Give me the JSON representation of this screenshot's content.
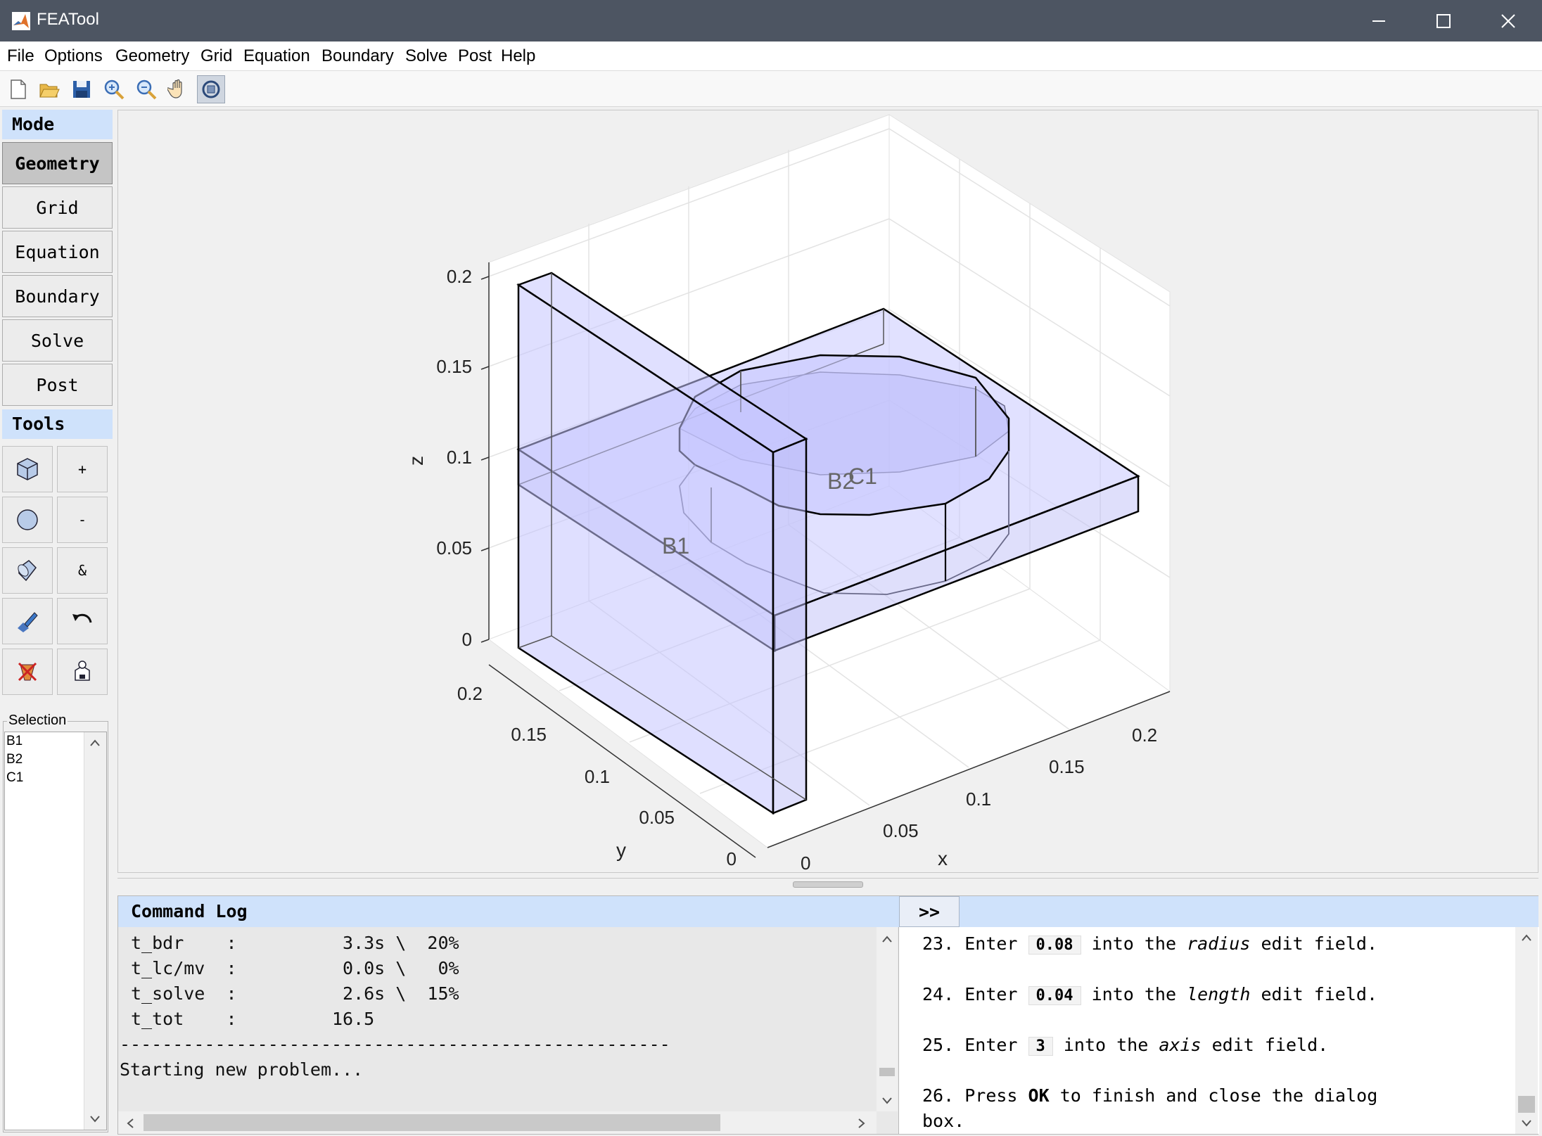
{
  "window": {
    "title": "FEATool"
  },
  "menu": [
    "File",
    "Options",
    "Geometry",
    "Grid",
    "Equation",
    "Boundary",
    "Solve",
    "Post",
    "Help"
  ],
  "toolbar": {
    "icons": [
      "new-file-icon",
      "open-folder-icon",
      "save-icon",
      "zoom-in-icon",
      "zoom-out-icon",
      "pan-hand-icon",
      "rotate-3d-icon"
    ]
  },
  "mode": {
    "header": "Mode",
    "buttons": [
      "Geometry",
      "Grid",
      "Equation",
      "Boundary",
      "Solve",
      "Post"
    ],
    "active": "Geometry"
  },
  "tools": {
    "header": "Tools",
    "left_icons": [
      "cube-icon",
      "circle-icon",
      "cylinder-icon",
      "edit-object-icon",
      "delete-object-icon"
    ],
    "right_labels": [
      "+",
      "-",
      "&"
    ],
    "right_icons": [
      "undo-icon",
      "export-geometry-icon"
    ]
  },
  "selection": {
    "label": "Selection",
    "items": [
      "B1",
      "B2",
      "C1"
    ]
  },
  "plot": {
    "axes": {
      "x_label": "x",
      "y_label": "y",
      "z_label": "z"
    },
    "z_ticks": [
      "0.2",
      "0.15",
      "0.1",
      "0.05",
      "0"
    ],
    "y_ticks": [
      "0.2",
      "0.15",
      "0.1",
      "0.05",
      "0"
    ],
    "x_ticks": [
      "0",
      "0.05",
      "0.1",
      "0.15",
      "0.2"
    ],
    "labels": [
      "B1",
      "B2",
      "C1"
    ]
  },
  "log": {
    "header": "Command Log",
    "toggle": ">>",
    "lines": [
      "t_bdr    :          3.3s \\  20%",
      "t_lc/mv  :          0.0s \\   0%",
      "t_solve  :          2.6s \\  15%",
      "t_tot    :         16.5",
      "----------------------------------------------------",
      "Starting new problem..."
    ]
  },
  "instructions": [
    {
      "num": "23.",
      "pre": "Enter",
      "value": "0.08",
      "mid": "into the",
      "field": "radius",
      "post": "edit field."
    },
    {
      "num": "24.",
      "pre": "Enter",
      "value": "0.04",
      "mid": "into the",
      "field": "length",
      "post": "edit field."
    },
    {
      "num": "25.",
      "pre": "Enter",
      "value": "3",
      "mid": "into the",
      "field": "axis",
      "post": "edit field."
    },
    {
      "num": "26.",
      "pre": "Press",
      "value": "OK",
      "mid": "",
      "field": "",
      "post": "to finish and close the dialog",
      "cont": "box."
    }
  ]
}
